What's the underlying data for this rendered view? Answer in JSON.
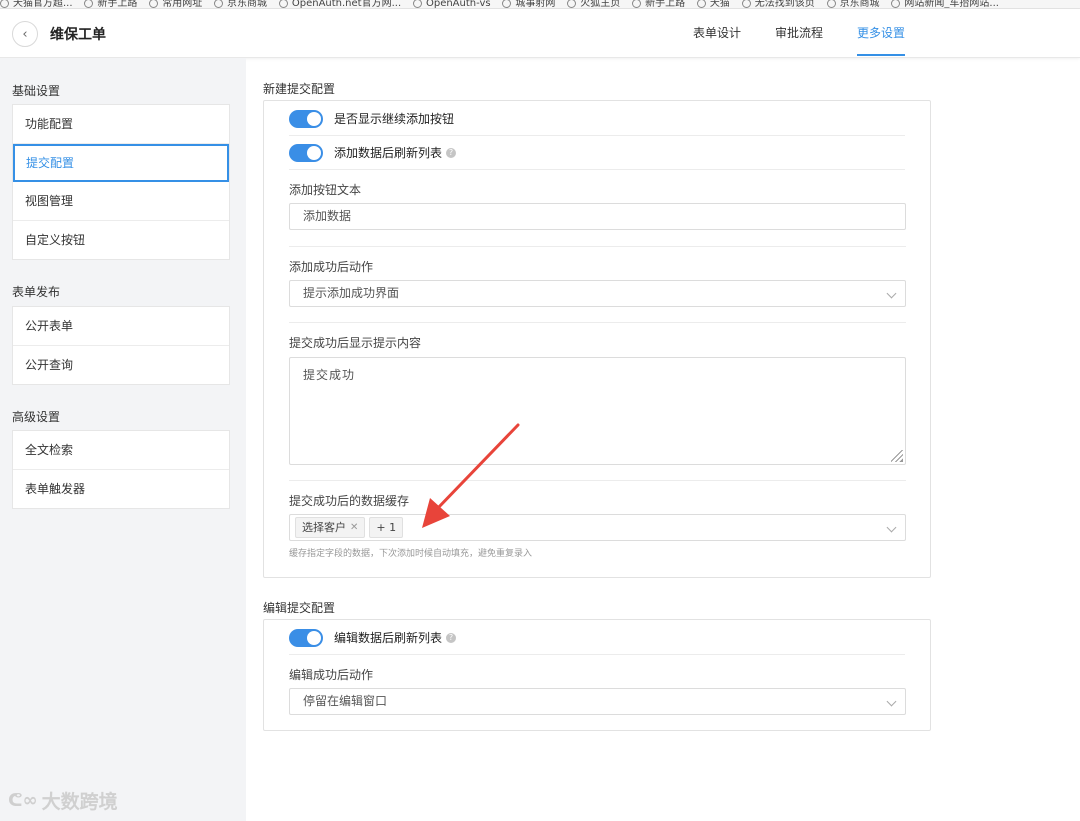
{
  "bookmarks": [
    "天猫官方超...",
    "新手上路",
    "常用网址",
    "京东商城",
    "OpenAuth.net官方网...",
    "OpenAuth-vs",
    "城事射网",
    "火狐主页",
    "新手上路",
    "天猫",
    "无法找到该页",
    "京东商城",
    "网站新闻_车抬网站..."
  ],
  "header": {
    "back_icon": "‹",
    "title": "维保工单",
    "tabs": [
      {
        "label": "表单设计"
      },
      {
        "label": "审批流程"
      },
      {
        "label": "更多设置",
        "active": true
      }
    ]
  },
  "sidebar": {
    "groups": [
      {
        "title": "基础设置",
        "items": [
          "功能配置",
          "提交配置",
          "视图管理",
          "自定义按钮"
        ]
      },
      {
        "title": "表单发布",
        "items": [
          "公开表单",
          "公开查询"
        ]
      },
      {
        "title": "高级设置",
        "items": [
          "全文检索",
          "表单触发器"
        ]
      }
    ],
    "active_item": "提交配置"
  },
  "new_submit": {
    "section_title": "新建提交配置",
    "toggle1_label": "是否显示继续添加按钮",
    "toggle2_label": "添加数据后刷新列表",
    "add_button_text_label": "添加按钮文本",
    "add_button_text_value": "添加数据",
    "after_add_action_label": "添加成功后动作",
    "after_add_action_value": "提示添加成功界面",
    "success_tip_label": "提交成功后显示提示内容",
    "success_tip_value": "提交成功",
    "cache_label": "提交成功后的数据缓存",
    "cache_tags": [
      "选择客户"
    ],
    "cache_more": "+ 1",
    "cache_hint": "缓存指定字段的数据，下次添加时候自动填充，避免重复录入"
  },
  "edit_submit": {
    "section_title": "编辑提交配置",
    "toggle_label": "编辑数据后刷新列表",
    "after_edit_action_label": "编辑成功后动作",
    "after_edit_action_value": "停留在编辑窗口"
  },
  "colors": {
    "accent": "#3590e6",
    "arrow": "#e8443a"
  },
  "watermark": "大数跨境"
}
